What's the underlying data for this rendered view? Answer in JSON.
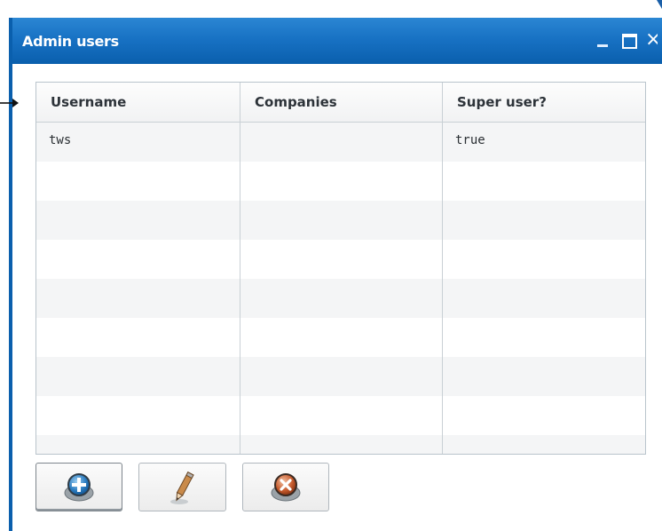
{
  "window": {
    "title": "Admin users",
    "controls": {
      "minimize": "_",
      "maximize": "□",
      "close": "×"
    }
  },
  "table": {
    "columns": [
      "Username",
      "Companies",
      "Super user?"
    ],
    "rows": [
      {
        "username": "tws",
        "companies": "",
        "super_user": "true"
      }
    ]
  },
  "toolbar": {
    "buttons": [
      {
        "name": "add",
        "icon": "add-user-icon"
      },
      {
        "name": "edit",
        "icon": "pencil-icon"
      },
      {
        "name": "delete",
        "icon": "delete-user-icon"
      }
    ]
  },
  "colors": {
    "titlebar": "#1872c4",
    "window_border": "#0a5fad",
    "grid_line": "#c9d0d5",
    "row_alt": "#f4f5f6"
  }
}
